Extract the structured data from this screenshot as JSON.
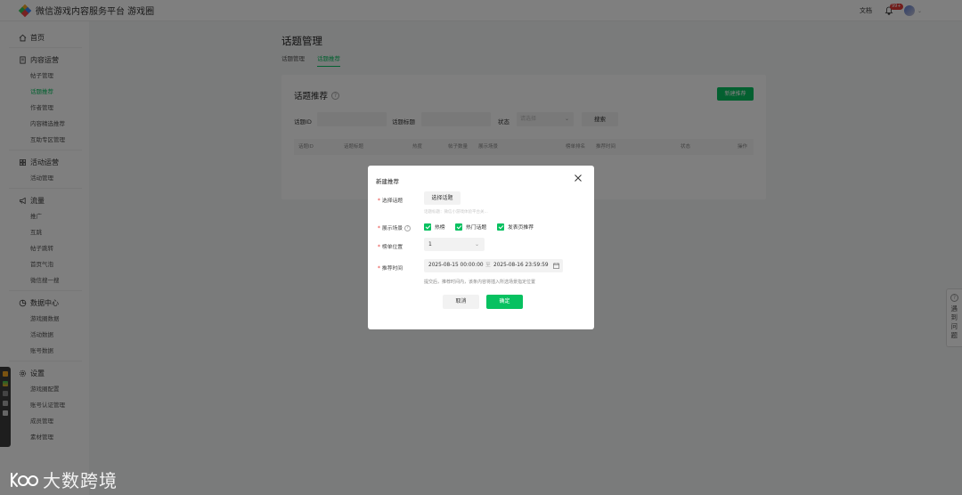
{
  "header": {
    "app_title": "微信游戏内容服务平台 游戏圈",
    "doc_link": "文档",
    "notification_count": "99+"
  },
  "sidebar": {
    "groups": [
      {
        "label": "首页",
        "icon": "home-icon",
        "items": []
      },
      {
        "label": "内容运营",
        "icon": "document-icon",
        "items": [
          "帖子管理",
          "话题推荐",
          "作者管理",
          "内容精选推荐",
          "互助专区管理"
        ]
      },
      {
        "label": "活动运营",
        "icon": "grid-icon",
        "items": [
          "活动管理"
        ]
      },
      {
        "label": "流量",
        "icon": "megaphone-icon",
        "items": [
          "推广",
          "互跳",
          "帖子跳转",
          "首页气泡",
          "微信搜一搜"
        ]
      },
      {
        "label": "数据中心",
        "icon": "pie-chart-icon",
        "items": [
          "游戏圈数据",
          "活动数据",
          "账号数据"
        ]
      },
      {
        "label": "设置",
        "icon": "gear-icon",
        "items": [
          "游戏圈配置",
          "账号认证管理",
          "成员管理",
          "素材管理"
        ]
      }
    ],
    "active_item": "话题推荐"
  },
  "page": {
    "title": "话题管理",
    "tabs": [
      {
        "label": "话题管理",
        "active": false
      },
      {
        "label": "话题推荐",
        "active": true
      }
    ]
  },
  "card": {
    "title": "话题推荐",
    "new_button": "新建推荐",
    "filters": {
      "topic_id_label": "话题ID",
      "topic_title_label": "话题标题",
      "status_label": "状态",
      "status_placeholder": "请选择",
      "search_button": "搜索"
    },
    "columns": [
      "话题ID",
      "话题标题",
      "热度",
      "帖子数量",
      "展示场景",
      "榜单排名",
      "推荐时间",
      "状态",
      "操作"
    ]
  },
  "dialog": {
    "title": "新建推荐",
    "fields": {
      "topic_label": "选择话题",
      "topic_button": "选择话题",
      "topic_hint": "话题标题：微信小游戏体验平台关...",
      "scene_label": "展示场景",
      "scenes": [
        "热榜",
        "热门话题",
        "发表页推荐"
      ],
      "rank_label": "榜单位置",
      "rank_value": "1",
      "time_label": "推荐时间",
      "start_time": "2025-08-15 00:00:00",
      "separator": "至",
      "end_time": "2025-08-16 23:59:59",
      "note": "提交后，推荐时间内，该条内容将插入所选场景指定位置"
    },
    "cancel_button": "取消",
    "ok_button": "确定"
  },
  "help_tab": {
    "label": "遇到问题"
  },
  "watermark": {
    "text": "大数跨境"
  },
  "colors": {
    "accent": "#07c160",
    "required": "#e53935",
    "overlay": "rgba(0,0,0,0.5)"
  }
}
